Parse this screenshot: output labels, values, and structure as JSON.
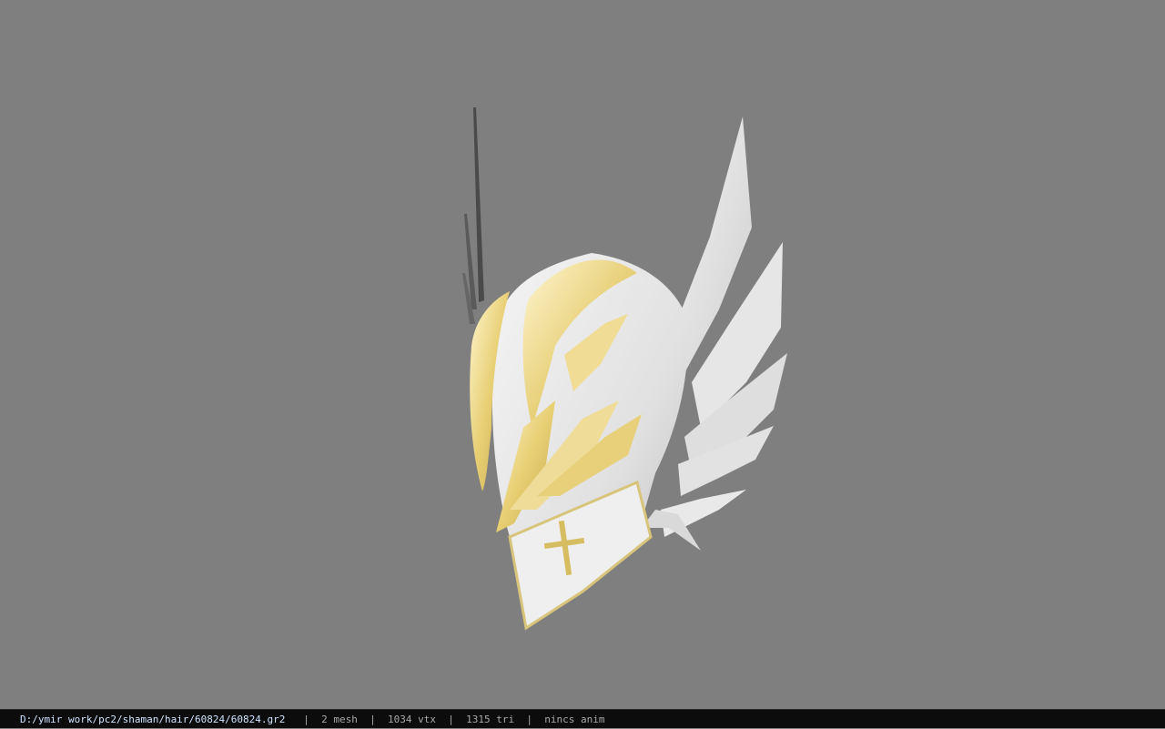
{
  "viewer": {
    "background_color": "#7f7f7f",
    "model": {
      "name": "winged-helmet",
      "primary_color": "#e9e9e9",
      "trim_color": "#e6cf7a",
      "wing_color": "#dcdcdc"
    }
  },
  "status_bar": {
    "path": "D:/ymir work/pc2/shaman/hair/60824/60824.gr2",
    "separator": "|",
    "mesh": "2 mesh",
    "vtx": "1034 vtx",
    "tri": "1315 tri",
    "anim": "nincs anim"
  }
}
